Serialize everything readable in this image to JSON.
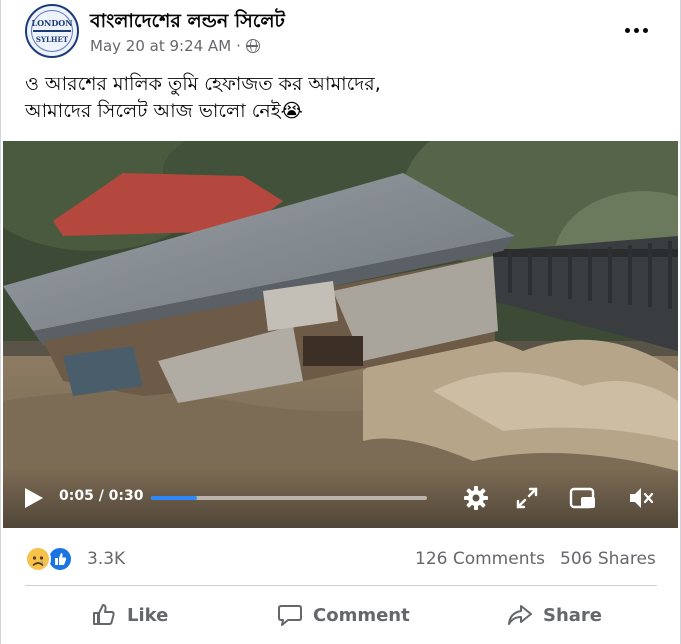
{
  "post": {
    "page_name": "বাংলাদেশের লন্ডন সিলেট",
    "avatar": {
      "line1": "LONDON",
      "line2": "SYLHET"
    },
    "timestamp": "May 20 at 9:24 AM",
    "separator": "·",
    "audience_icon": "globe-icon",
    "caption_line1": "ও আরশের মালিক তুমি হেফাজত কর আমাদের,",
    "caption_line2": "আমাদের সিলেট আজ ভালো নেই😭"
  },
  "video": {
    "current_time": "0:05",
    "duration": "0:30",
    "time_display": "0:05 / 0:30",
    "progress_fraction": 0.1667,
    "controls": [
      "play-icon",
      "settings-gear-icon",
      "fullscreen-icon",
      "picture-in-picture-icon",
      "mute-icon"
    ]
  },
  "engagement": {
    "reaction_icons": [
      "sad-reaction-icon",
      "like-reaction-icon"
    ],
    "reaction_count": "3.3K",
    "comments": "126 Comments",
    "shares": "506 Shares"
  },
  "actions": {
    "like_label": "Like",
    "comment_label": "Comment",
    "share_label": "Share"
  },
  "colors": {
    "text_primary": "#050505",
    "text_secondary": "#65676b",
    "accent_blue": "#1b74e4",
    "progress_blue": "#2d88ff",
    "sad_yellow": "#f7c24a"
  }
}
